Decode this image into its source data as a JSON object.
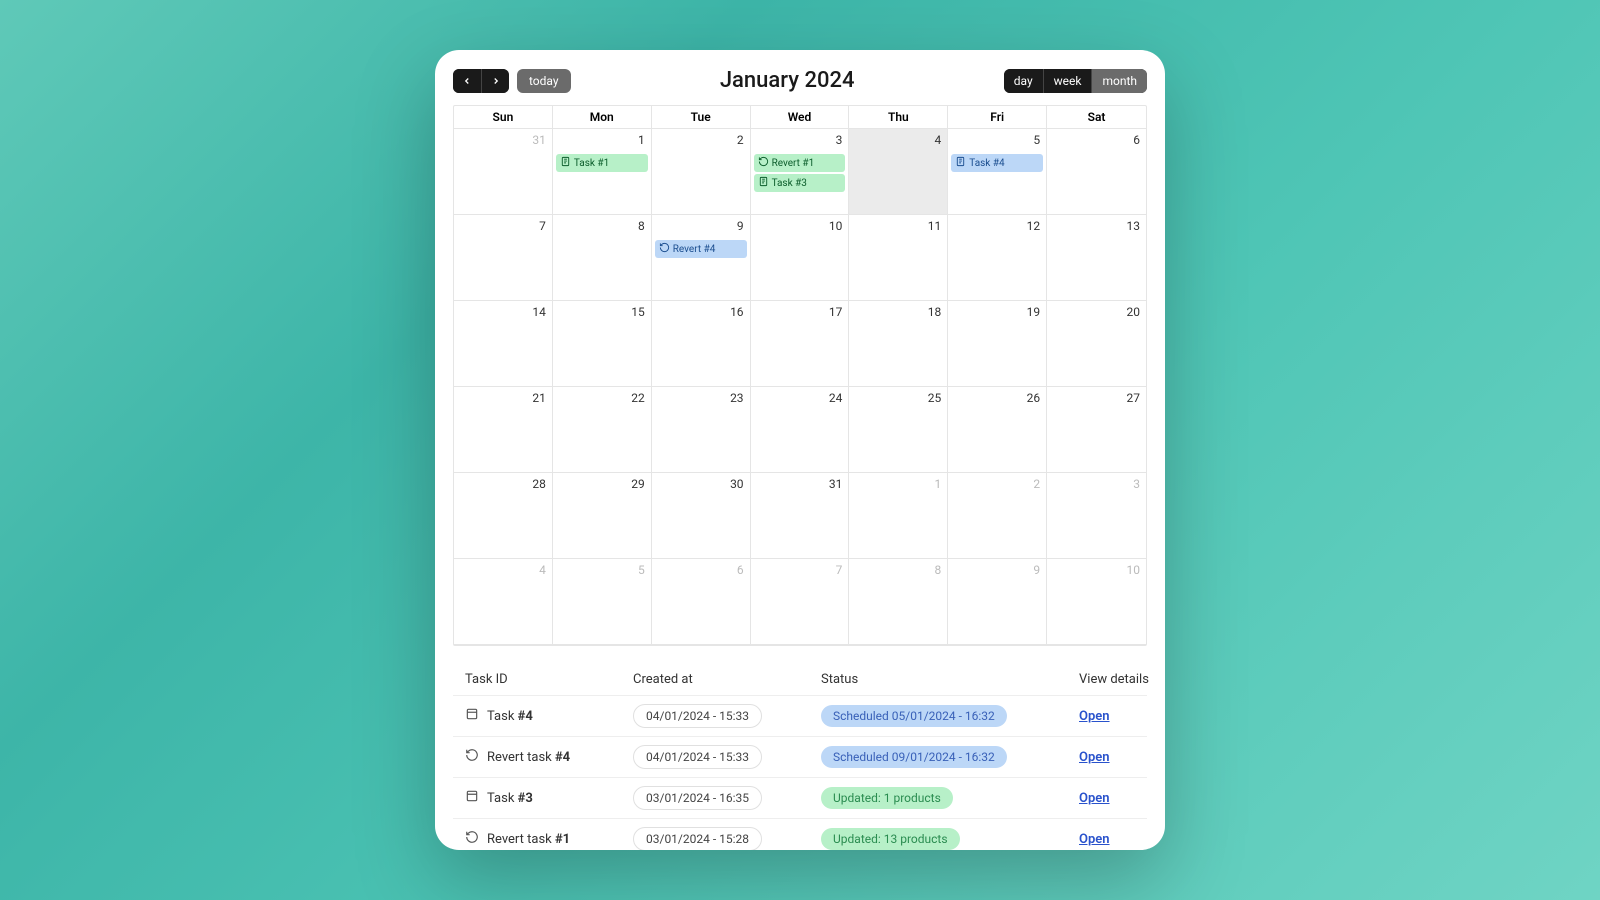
{
  "toolbar": {
    "today": "today",
    "title": "January 2024",
    "views": {
      "day": "day",
      "week": "week",
      "month": "month"
    }
  },
  "dow": [
    "Sun",
    "Mon",
    "Tue",
    "Wed",
    "Thu",
    "Fri",
    "Sat"
  ],
  "weeks": [
    [
      {
        "n": "31",
        "o": true
      },
      {
        "n": "1",
        "ev": [
          {
            "t": "Task #1",
            "c": "green",
            "i": "task"
          }
        ]
      },
      {
        "n": "2"
      },
      {
        "n": "3",
        "ev": [
          {
            "t": "Revert #1",
            "c": "green",
            "i": "revert"
          },
          {
            "t": "Task #3",
            "c": "green",
            "i": "task"
          }
        ]
      },
      {
        "n": "4",
        "today": true
      },
      {
        "n": "5",
        "ev": [
          {
            "t": "Task #4",
            "c": "blue",
            "i": "task"
          }
        ]
      },
      {
        "n": "6"
      }
    ],
    [
      {
        "n": "7"
      },
      {
        "n": "8"
      },
      {
        "n": "9",
        "ev": [
          {
            "t": "Revert #4",
            "c": "blue",
            "i": "revert"
          }
        ]
      },
      {
        "n": "10"
      },
      {
        "n": "11"
      },
      {
        "n": "12"
      },
      {
        "n": "13"
      }
    ],
    [
      {
        "n": "14"
      },
      {
        "n": "15"
      },
      {
        "n": "16"
      },
      {
        "n": "17"
      },
      {
        "n": "18"
      },
      {
        "n": "19"
      },
      {
        "n": "20"
      }
    ],
    [
      {
        "n": "21"
      },
      {
        "n": "22"
      },
      {
        "n": "23"
      },
      {
        "n": "24"
      },
      {
        "n": "25"
      },
      {
        "n": "26"
      },
      {
        "n": "27"
      }
    ],
    [
      {
        "n": "28"
      },
      {
        "n": "29"
      },
      {
        "n": "30"
      },
      {
        "n": "31"
      },
      {
        "n": "1",
        "o": true
      },
      {
        "n": "2",
        "o": true
      },
      {
        "n": "3",
        "o": true
      }
    ],
    [
      {
        "n": "4",
        "o": true
      },
      {
        "n": "5",
        "o": true
      },
      {
        "n": "6",
        "o": true
      },
      {
        "n": "7",
        "o": true
      },
      {
        "n": "8",
        "o": true
      },
      {
        "n": "9",
        "o": true
      },
      {
        "n": "10",
        "o": true
      }
    ]
  ],
  "table": {
    "headers": {
      "id": "Task ID",
      "created": "Created at",
      "status": "Status",
      "details": "View details"
    },
    "open": "Open",
    "rows": [
      {
        "icon": "task",
        "name": "Task ",
        "num": "#4",
        "created": "04/01/2024 - 15:33",
        "status": "Scheduled 05/01/2024 - 16:32",
        "sc": "blue"
      },
      {
        "icon": "revert",
        "name": "Revert task ",
        "num": "#4",
        "created": "04/01/2024 - 15:33",
        "status": "Scheduled 09/01/2024 - 16:32",
        "sc": "blue"
      },
      {
        "icon": "task",
        "name": "Task ",
        "num": "#3",
        "created": "03/01/2024 - 16:35",
        "status": "Updated: 1 products",
        "sc": "green"
      },
      {
        "icon": "revert",
        "name": "Revert task ",
        "num": "#1",
        "created": "03/01/2024 - 15:28",
        "status": "Updated: 13 products",
        "sc": "green"
      }
    ]
  }
}
